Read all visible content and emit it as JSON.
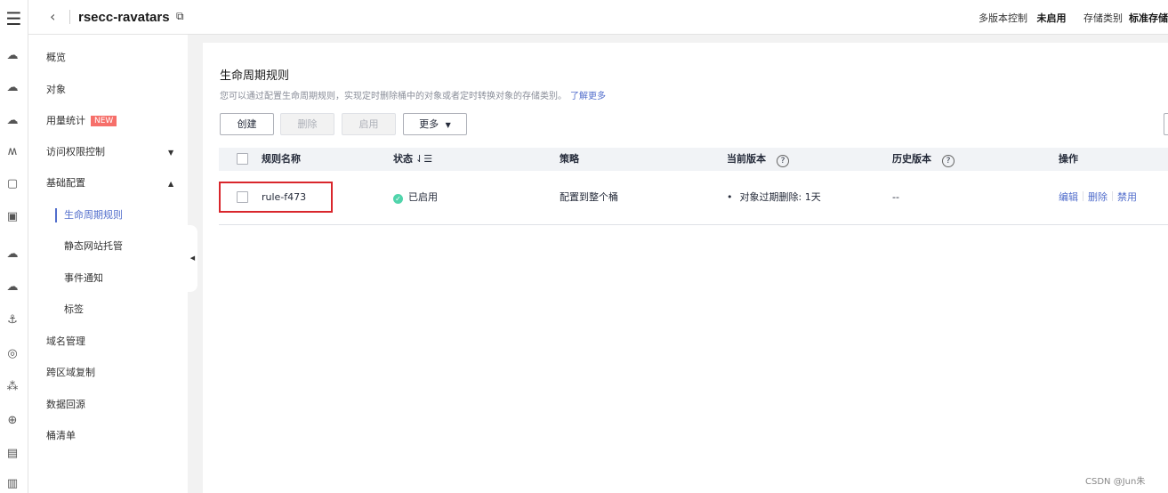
{
  "header": {
    "bucket_name": "rsecc-ravatars",
    "versioning_label": "多版本控制",
    "versioning_value": "未启用",
    "storage_class_label": "存储类别",
    "storage_class_value": "标准存储"
  },
  "sidebar": {
    "overview": "概览",
    "objects": "对象",
    "usage": "用量统计",
    "usage_badge": "NEW",
    "access_control": "访问权限控制",
    "basic_config": "基础配置",
    "lifecycle": "生命周期规则",
    "static_website": "静态网站托管",
    "event_notification": "事件通知",
    "tags": "标签",
    "domain_mgmt": "域名管理",
    "cross_region": "跨区域复制",
    "back_to_source": "数据回源",
    "inventory": "桶清单"
  },
  "main": {
    "title": "生命周期规则",
    "description": "您可以通过配置生命周期规则，实现定时删除桶中的对象或者定时转换对象的存储类别。",
    "learn_more": "了解更多",
    "buttons": {
      "create": "创建",
      "delete": "删除",
      "enable": "启用",
      "more": "更多"
    },
    "table": {
      "columns": {
        "name": "规则名称",
        "status": "状态",
        "policy": "策略",
        "current_version": "当前版本",
        "history_version": "历史版本",
        "actions": "操作"
      },
      "rows": [
        {
          "name": "rule-f473",
          "status": "已启用",
          "policy": "配置到整个桶",
          "current_version": "对象过期删除: 1天",
          "history_version": "--",
          "actions": {
            "edit": "编辑",
            "delete": "删除",
            "disable": "禁用"
          }
        }
      ]
    }
  },
  "watermark": "CSDN @Jun朱",
  "colors": {
    "accent": "#526ecc",
    "status_enabled": "#50d4ab",
    "badge": "#f66f6a",
    "highlight": "#d9262c"
  }
}
